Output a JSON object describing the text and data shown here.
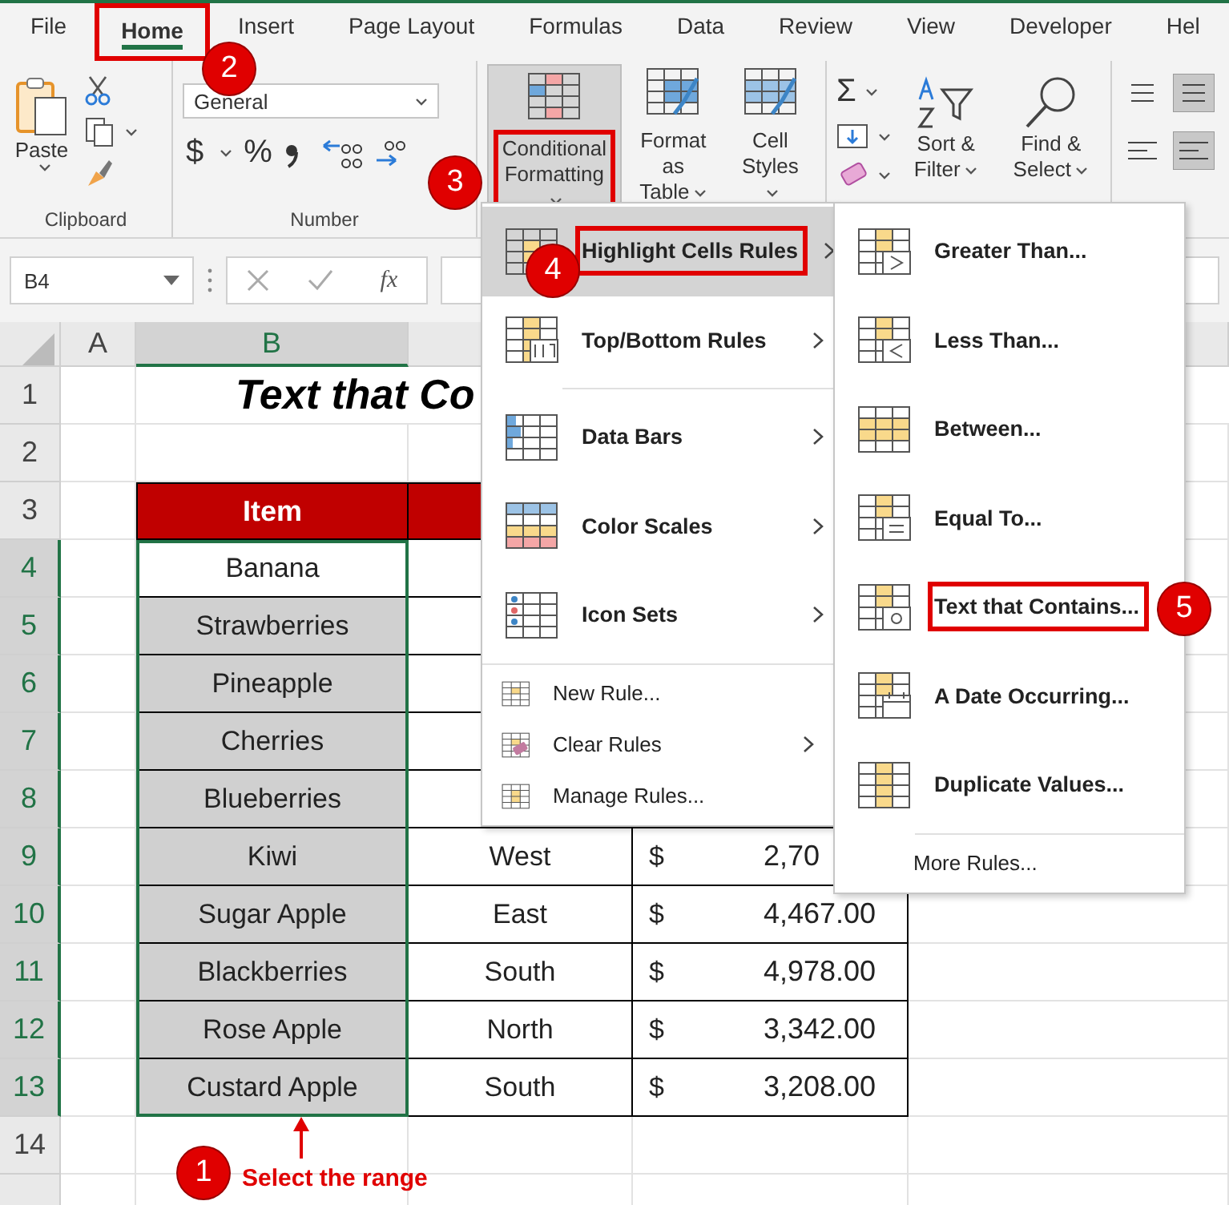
{
  "tabs": [
    {
      "label": "File",
      "selected": false,
      "marked": false
    },
    {
      "label": "Home",
      "selected": true,
      "marked": true
    },
    {
      "label": "Insert",
      "selected": false,
      "marked": false
    },
    {
      "label": "Page Layout",
      "selected": false,
      "marked": false
    },
    {
      "label": "Formulas",
      "selected": false,
      "marked": false
    },
    {
      "label": "Data",
      "selected": false,
      "marked": false
    },
    {
      "label": "Review",
      "selected": false,
      "marked": false
    },
    {
      "label": "View",
      "selected": false,
      "marked": false
    },
    {
      "label": "Developer",
      "selected": false,
      "marked": false
    },
    {
      "label": "Hel",
      "selected": false,
      "marked": false
    }
  ],
  "ribbon": {
    "paste": "Paste",
    "clipboard_label": "Clipboard",
    "number_format": "General",
    "currency": "$",
    "percent": "%",
    "number_label": "Number",
    "style_buttons": [
      {
        "label": "Conditional Formatting",
        "marked": true
      },
      {
        "label": "Format as Table",
        "marked": false
      },
      {
        "label": "Cell Styles",
        "marked": false
      }
    ],
    "autosum": "Σ",
    "sort_filter": "Sort & Filter",
    "find_select": "Find & Select"
  },
  "formula_bar": {
    "name_box": "B4",
    "fx": "fx"
  },
  "sheet": {
    "columns": [
      {
        "label": "A",
        "selected": false
      },
      {
        "label": "B",
        "selected": true
      }
    ],
    "row_numbers": [
      {
        "label": "1",
        "selected": false
      },
      {
        "label": "2",
        "selected": false
      },
      {
        "label": "3",
        "selected": false
      },
      {
        "label": "4",
        "selected": true
      },
      {
        "label": "5",
        "selected": true
      },
      {
        "label": "6",
        "selected": true
      },
      {
        "label": "7",
        "selected": true
      },
      {
        "label": "8",
        "selected": true
      },
      {
        "label": "9",
        "selected": true
      },
      {
        "label": "10",
        "selected": true
      },
      {
        "label": "11",
        "selected": true
      },
      {
        "label": "12",
        "selected": true
      },
      {
        "label": "13",
        "selected": true
      },
      {
        "label": "14",
        "selected": false
      }
    ],
    "title": "Text that Co",
    "header": "Item",
    "rows": [
      {
        "item": "Banana",
        "active": true
      },
      {
        "item": "Strawberries",
        "active": false
      },
      {
        "item": "Pineapple",
        "active": false
      },
      {
        "item": "Cherries",
        "active": false
      },
      {
        "item": "Blueberries",
        "active": false
      },
      {
        "item": "Kiwi",
        "active": false,
        "region": "West",
        "currency": "$",
        "amount": "2,70"
      },
      {
        "item": "Sugar Apple",
        "active": false,
        "region": "East",
        "currency": "$",
        "amount": "4,467.00"
      },
      {
        "item": "Blackberries",
        "active": false,
        "region": "South",
        "currency": "$",
        "amount": "4,978.00"
      },
      {
        "item": "Rose Apple",
        "active": false,
        "region": "North",
        "currency": "$",
        "amount": "3,342.00"
      },
      {
        "item": "Custard Apple",
        "active": false,
        "region": "South",
        "currency": "$",
        "amount": "3,208.00"
      }
    ]
  },
  "cf_menu": {
    "items": [
      {
        "kind": "large",
        "label": "Highlight Cells Rules",
        "submenu": true,
        "highlighted": true,
        "marked": true
      },
      {
        "kind": "large",
        "label": "Top/Bottom Rules",
        "submenu": true,
        "highlighted": false,
        "marked": false
      },
      {
        "kind": "separator"
      },
      {
        "kind": "large",
        "label": "Data Bars",
        "submenu": true,
        "highlighted": false,
        "marked": false
      },
      {
        "kind": "large",
        "label": "Color Scales",
        "submenu": true,
        "highlighted": false,
        "marked": false
      },
      {
        "kind": "large",
        "label": "Icon Sets",
        "submenu": true,
        "highlighted": false,
        "marked": false
      },
      {
        "kind": "separator"
      },
      {
        "kind": "small",
        "label": "New Rule...",
        "submenu": false,
        "highlighted": false,
        "marked": false
      },
      {
        "kind": "small",
        "label": "Clear Rules",
        "submenu": true,
        "highlighted": false,
        "marked": false
      },
      {
        "kind": "small",
        "label": "Manage Rules...",
        "submenu": false,
        "highlighted": false,
        "marked": false
      }
    ]
  },
  "highlight_submenu": {
    "items": [
      {
        "kind": "large",
        "label": "Greater Than...",
        "marked": false
      },
      {
        "kind": "large",
        "label": "Less Than...",
        "marked": false
      },
      {
        "kind": "large",
        "label": "Between...",
        "marked": false
      },
      {
        "kind": "large",
        "label": "Equal To...",
        "marked": false
      },
      {
        "kind": "large",
        "label": "Text that Contains...",
        "marked": true
      },
      {
        "kind": "large",
        "label": "A Date Occurring...",
        "marked": false
      },
      {
        "kind": "large",
        "label": "Duplicate Values...",
        "marked": false
      },
      {
        "kind": "separator"
      },
      {
        "kind": "small",
        "label": "More Rules...",
        "marked": false
      }
    ]
  },
  "callouts": [
    {
      "number": "1"
    },
    {
      "number": "2"
    },
    {
      "number": "3"
    },
    {
      "number": "4"
    },
    {
      "number": "5"
    }
  ],
  "range_note": "Select the range"
}
